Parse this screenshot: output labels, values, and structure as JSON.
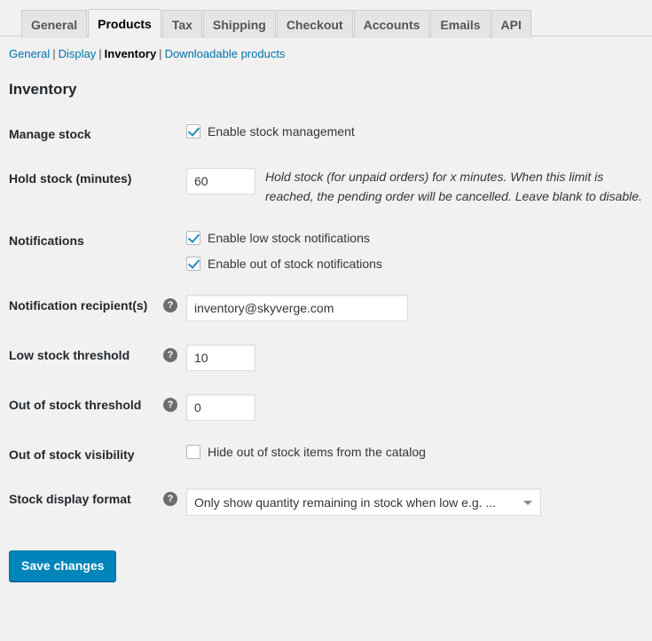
{
  "tabs": [
    {
      "label": "General",
      "active": false
    },
    {
      "label": "Products",
      "active": true
    },
    {
      "label": "Tax",
      "active": false
    },
    {
      "label": "Shipping",
      "active": false
    },
    {
      "label": "Checkout",
      "active": false
    },
    {
      "label": "Accounts",
      "active": false
    },
    {
      "label": "Emails",
      "active": false
    },
    {
      "label": "API",
      "active": false
    }
  ],
  "subnav": {
    "items": [
      {
        "label": "General",
        "current": false
      },
      {
        "label": "Display",
        "current": false
      },
      {
        "label": "Inventory",
        "current": true
      },
      {
        "label": "Downloadable products",
        "current": false
      }
    ],
    "separator": "|"
  },
  "page_title": "Inventory",
  "help_icon": "?",
  "rows": {
    "manage_stock": {
      "label": "Manage stock",
      "checkbox_label": "Enable stock management",
      "checked": true
    },
    "hold_stock": {
      "label": "Hold stock (minutes)",
      "value": "60",
      "description": "Hold stock (for unpaid orders) for x minutes. When this limit is reached, the pending order will be cancelled. Leave blank to disable."
    },
    "notifications": {
      "label": "Notifications",
      "low_stock_label": "Enable low stock notifications",
      "low_stock_checked": true,
      "out_of_stock_label": "Enable out of stock notifications",
      "out_of_stock_checked": true
    },
    "notification_recipients": {
      "label": "Notification recipient(s)",
      "value": "inventory@skyverge.com",
      "has_help": true
    },
    "low_stock_threshold": {
      "label": "Low stock threshold",
      "value": "10",
      "has_help": true
    },
    "out_of_stock_threshold": {
      "label": "Out of stock threshold",
      "value": "0",
      "has_help": true
    },
    "out_of_stock_visibility": {
      "label": "Out of stock visibility",
      "checkbox_label": "Hide out of stock items from the catalog",
      "checked": false
    },
    "stock_display_format": {
      "label": "Stock display format",
      "has_help": true,
      "selected": "Only show quantity remaining in stock when low e.g. ..."
    }
  },
  "submit": {
    "label": "Save changes"
  },
  "colors": {
    "primary_button": "#0085ba",
    "link": "#0073aa",
    "checkbox_check": "#1e8cbe",
    "page_background": "#f1f1f1"
  }
}
